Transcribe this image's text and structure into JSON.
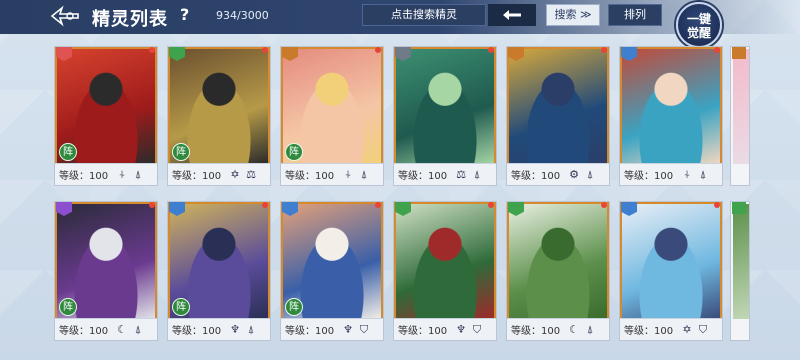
{
  "header": {
    "title": "精灵列表",
    "help": "?",
    "count": "934/3000",
    "search_placeholder": "点击搜索精灵",
    "filter_label": "搜索 ≫",
    "sort_label": "排列",
    "awaken_line1": "一键",
    "awaken_line2": "觉醒"
  },
  "level_label": "等级：100",
  "cards": [
    {
      "art": [
        "#9e1b1b",
        "#d7432e",
        "#2b2b2b"
      ],
      "badge": "#e05353",
      "zhen": true,
      "icons": [
        "⍭",
        "⍋"
      ]
    },
    {
      "art": [
        "#b69a48",
        "#6b5030",
        "#2a2a2a"
      ],
      "badge": "#3fa34d",
      "zhen": true,
      "icons": [
        "✡",
        "⚖"
      ]
    },
    {
      "art": [
        "#f4c6a6",
        "#e58b7e",
        "#f2d07a"
      ],
      "badge": "#c97a2b",
      "zhen": true,
      "icons": [
        "⍭",
        "⍋"
      ]
    },
    {
      "art": [
        "#1f5a4f",
        "#3d8f72",
        "#a7d6a5"
      ],
      "badge": "#6f7b86",
      "zhen": false,
      "icons": [
        "⚖",
        "⍋"
      ]
    },
    {
      "art": [
        "#214a7a",
        "#d6a83b",
        "#2b3e68"
      ],
      "badge": "#c97a2b",
      "zhen": false,
      "icons": [
        "⚙",
        "⍋"
      ]
    },
    {
      "art": [
        "#3aa3c2",
        "#c24a3a",
        "#f1d7c1"
      ],
      "badge": "#3f7fd0",
      "zhen": false,
      "icons": [
        "⍭",
        "⍋"
      ]
    },
    {
      "art": [
        "#6a3a8f",
        "#2b2b3a",
        "#e3e3ea"
      ],
      "badge": "#8b4fd0",
      "zhen": true,
      "icons": [
        "☾",
        "⍋"
      ]
    },
    {
      "art": [
        "#5a4c9a",
        "#d0b35a",
        "#2a2f55"
      ],
      "badge": "#3f7fd0",
      "zhen": true,
      "icons": [
        "♆",
        "⍋"
      ]
    },
    {
      "art": [
        "#3a5fa8",
        "#e3a07a",
        "#f3efe8"
      ],
      "badge": "#3f7fd0",
      "zhen": true,
      "icons": [
        "♆",
        "⛉"
      ]
    },
    {
      "art": [
        "#2f6b3a",
        "#cfe0c4",
        "#9e2a2a"
      ],
      "badge": "#3fa34d",
      "zhen": false,
      "icons": [
        "♆",
        "⛉"
      ]
    },
    {
      "art": [
        "#5b8f4a",
        "#e8efe0",
        "#3a6b2e"
      ],
      "badge": "#3fa34d",
      "zhen": false,
      "icons": [
        "☾",
        "⍋"
      ]
    },
    {
      "art": [
        "#6fb8e0",
        "#e9eef6",
        "#3a4a7a"
      ],
      "badge": "#3f7fd0",
      "zhen": false,
      "icons": [
        "✡",
        "⛉"
      ]
    }
  ],
  "partial_cards": [
    {
      "art": [
        "#f4b9c8",
        "#e8e0ea"
      ],
      "badge": "#c97a2b"
    },
    {
      "art": [
        "#5b8f4a",
        "#cfe0c4"
      ],
      "badge": "#3fa34d"
    }
  ]
}
